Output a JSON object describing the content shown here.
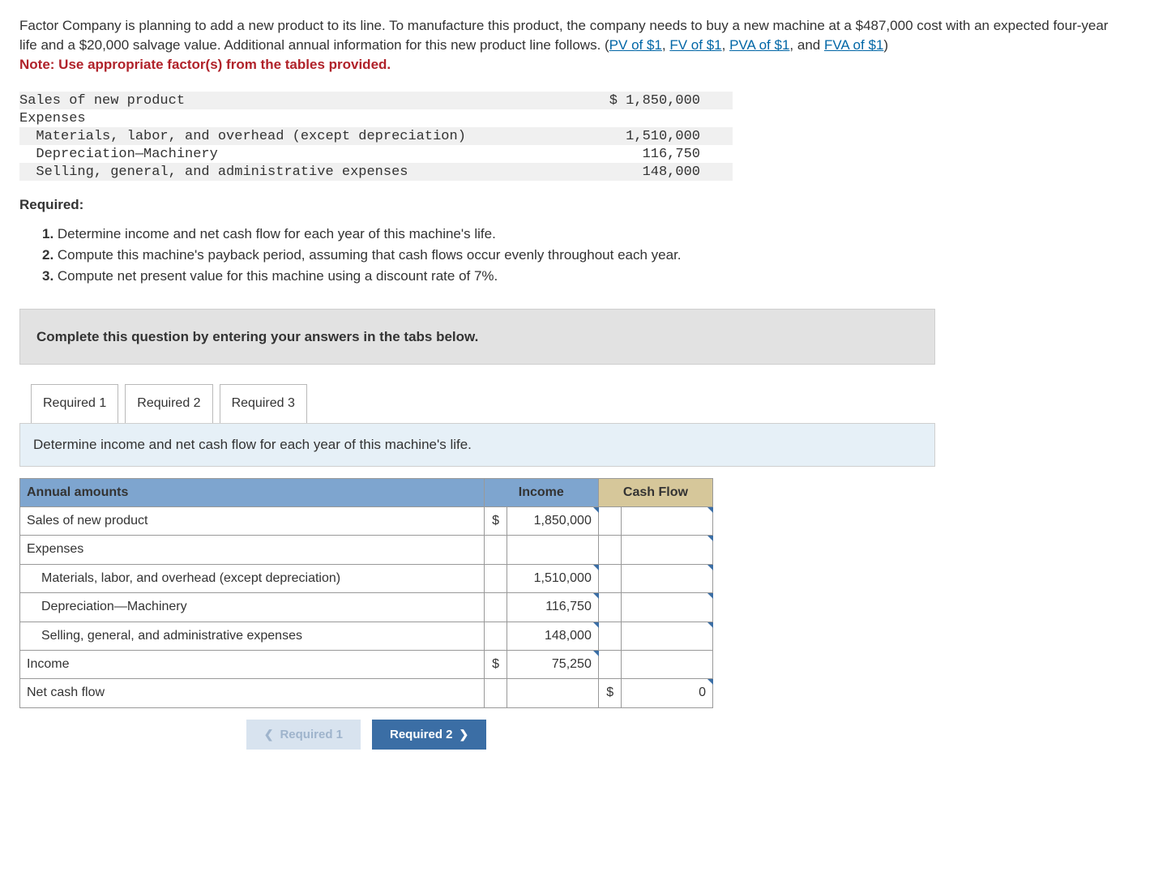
{
  "intro": {
    "text_before_links": "Factor Company is planning to add a new product to its line. To manufacture this product, the company needs to buy a new machine at a $487,000 cost with an expected four-year life and a $20,000 salvage value. Additional annual information for this new product line follows. (",
    "links": [
      "PV of $1",
      "FV of $1",
      "PVA of $1",
      "FVA of $1"
    ],
    "link_sep": ", ",
    "link_and": ", and ",
    "text_after_links": ")",
    "note": "Note: Use appropriate factor(s) from the tables provided."
  },
  "data_rows": [
    {
      "label": "Sales of new product",
      "value": "$ 1,850,000",
      "indent": 0,
      "stripe": true
    },
    {
      "label": "Expenses",
      "value": "",
      "indent": 0,
      "stripe": false
    },
    {
      "label": "Materials, labor, and overhead (except depreciation)",
      "value": "1,510,000",
      "indent": 1,
      "stripe": true
    },
    {
      "label": "Depreciation—Machinery",
      "value": "116,750",
      "indent": 1,
      "stripe": false
    },
    {
      "label": "Selling, general, and administrative expenses",
      "value": "148,000",
      "indent": 1,
      "stripe": true
    }
  ],
  "required_heading": "Required:",
  "required_items": [
    "Determine income and net cash flow for each year of this machine's life.",
    "Compute this machine's payback period, assuming that cash flows occur evenly throughout each year.",
    "Compute net present value for this machine using a discount rate of 7%."
  ],
  "instruction": "Complete this question by entering your answers in the tabs below.",
  "tabs": [
    "Required 1",
    "Required 2",
    "Required 3"
  ],
  "tab_instruction": "Determine income and net cash flow for each year of this machine's life.",
  "table": {
    "headers": [
      "Annual amounts",
      "Income",
      "Cash Flow"
    ],
    "rows": [
      {
        "label": "Sales of new product",
        "indent": 0,
        "income_cur": "$",
        "income_val": "1,850,000",
        "cash_cur": "",
        "cash_val": "",
        "inc_edit": true,
        "cash_edit": true
      },
      {
        "label": "Expenses",
        "indent": 0,
        "income_cur": "",
        "income_val": "",
        "cash_cur": "",
        "cash_val": "",
        "inc_edit": false,
        "cash_edit": true
      },
      {
        "label": "Materials, labor, and overhead (except depreciation)",
        "indent": 1,
        "income_cur": "",
        "income_val": "1,510,000",
        "cash_cur": "",
        "cash_val": "",
        "inc_edit": true,
        "cash_edit": true
      },
      {
        "label": "Depreciation—Machinery",
        "indent": 1,
        "income_cur": "",
        "income_val": "116,750",
        "cash_cur": "",
        "cash_val": "",
        "inc_edit": true,
        "cash_edit": true
      },
      {
        "label": "Selling, general, and administrative expenses",
        "indent": 1,
        "income_cur": "",
        "income_val": "148,000",
        "cash_cur": "",
        "cash_val": "",
        "inc_edit": true,
        "cash_edit": true
      },
      {
        "label": "Income",
        "indent": 0,
        "income_cur": "$",
        "income_val": "75,250",
        "cash_cur": "",
        "cash_val": "",
        "inc_edit": true,
        "cash_edit": false
      },
      {
        "label": "Net cash flow",
        "indent": 0,
        "income_cur": "",
        "income_val": "",
        "cash_cur": "$",
        "cash_val": "0",
        "inc_edit": false,
        "cash_edit": true
      }
    ]
  },
  "nav": {
    "prev": "Required 1",
    "next": "Required 2"
  }
}
